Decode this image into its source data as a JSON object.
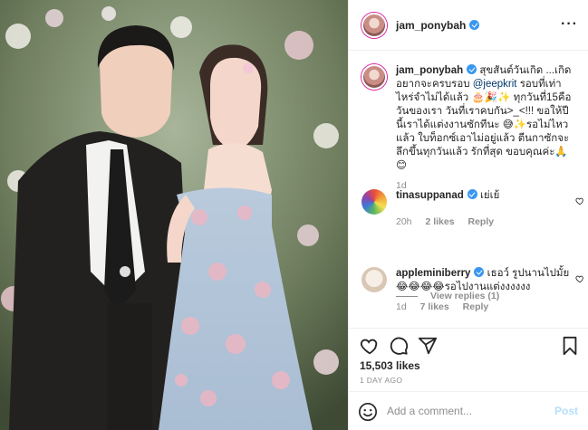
{
  "post": {
    "username": "jam_ponybah",
    "caption": "สุขสันต์วันเกิด ...เกิดอยากจะครบรอบ",
    "mention": "@jeepkrit",
    "caption_rest": "รอบที่เท่าไหร่จำไม่ได้แล้ว 🎂🎉✨ ทุกวันที่15คือวันของเรา วันที่เราคบกัน>_<!!! ขอให้ปีนี้เราได้แต่งงานซักทีนะ 😅✨รอไม่ไหวแล้ว ใบท็อกซ์เอาไม่อยู่แล้ว ตีนกาซักจะลึกขึ้นทุกวันแล้ว รักที่สุด ขอบคุณค่ะ🙏😊",
    "caption_time": "1d"
  },
  "comments": [
    {
      "user": "tinasuppanad",
      "verified": true,
      "text": "เย่เย้",
      "time": "20h",
      "likes": "2 likes",
      "reply": "Reply"
    },
    {
      "user": "appleminiberry",
      "verified": true,
      "text": "เธอว์ รูปนานไปมั้ย😂😂😂😂รอไปงานแต่งงงงงง",
      "time": "1d",
      "likes": "7 likes",
      "reply": "Reply"
    }
  ],
  "view_replies": "View replies (1)",
  "likes_count": "15,503 likes",
  "date": "1 DAY AGO",
  "add_comment": {
    "placeholder": "Add a comment...",
    "post_label": "Post"
  },
  "icons": {
    "like": "heart-icon",
    "comment": "comment-icon",
    "share": "share-icon",
    "save": "bookmark-icon",
    "emoji": "emoji-icon",
    "more": "more-icon"
  },
  "colors": {
    "verified": "#3897f0",
    "mention": "#00376b",
    "post_disabled": "#b2dffc",
    "muted": "#8e8e8e"
  }
}
